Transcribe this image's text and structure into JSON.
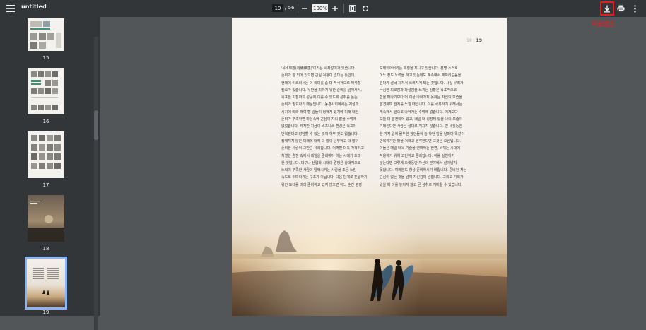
{
  "toolbar": {
    "document_title": "untitled",
    "current_page": "19",
    "page_count": "/ 56",
    "zoom_level": "100%"
  },
  "sidebar": {
    "thumbnails": [
      {
        "label": "15"
      },
      {
        "label": "16"
      },
      {
        "label": "17"
      },
      {
        "label": "18"
      },
      {
        "label": "19"
      }
    ]
  },
  "annotation": {
    "label": "다운로드"
  },
  "page": {
    "page_number": "19",
    "left_column": [
      "'유비무환(有備無患)'이라는 사자성어가 있습니다.",
      "준비가 잘 되어 있으면 근심 걱정이 없다는 뜻인데,",
      "현대에 이르러서는 이 의미를 좀 더 적극적으로 해석할",
      "필요가 있습니다. 우환을 피하기 위한 준비를 넘어서서,",
      "목표한 지점까지 성공에 이를 수 있도록 성취를 돕는",
      "준비가 필요하기 때문입니다. 농경사회에서는 계절과",
      "시기에 따라 해야 할 일들이 정해져 있기에 미래 대한",
      "준비가 부족하면 마음속에 근심이 자리 잡을 수밖에",
      "없었습니다. 하지만 지금의 비즈니스 환경은 목표이",
      "반복된다고 장담할 수 있는 것이 아무 것도 없습니다.",
      "정해지지 않은 미래에 대해 더 많이 공부하고 더 많이",
      "준비한 사람이 그만큼 유리합니다. 어쩌면 더욱 가혹하고",
      "치열한 경쟁 속에서 내일을 준비해야 하는 시대가 도래",
      "한 것입니다. 더구나 산업화 시대의 경쟁은 상대적으로",
      "노력이 부족한 사람이 탈락시키는 사람을 조금 느린",
      "속도로 뒤따라가는 구조가 아닙니다. 다음 단계로 진입하기",
      "위한 토대를 미리 준비하고 있지 않으면 어느 순간 영영"
    ],
    "right_column": [
      "도태되어버리는 특징을 지니고 있습니다. 분명 스스로",
      "어느 정도 노력을 하고 있는데도 계속해서 제자리걸음을",
      "걷다가 결국 지쳐서 쓰러지게 되는 것입니다. 사실 우리가",
      "극심한 피로감과 좌절감을 느끼는 상황은 목표적으로",
      "힘을 떠나기보다 더 이상 나아가지 못하는 자신의 모습을",
      "발견하며 한계를 느낄 때입니다. 이를 극복하기 위해서는",
      "계속해서 앞으로 나아가는 수밖에 없습니다. 어제보다",
      "오늘 더 발전되어 있고, 내일 더 성장해 있을 나의 모습이",
      "기대된다면 사람은 절대로 지치지 않습니다. 긴 세월동안",
      "한 가지 일에 몰두한 장인들이 늘 하던 일을 날마다 똑같이",
      "반복하기만 했을 거라고 생각한다면 그것은 오산입니다.",
      "이들은 매일 더욱 기술을 연마하는 한편, 바뀌는 시대에",
      "적응하기 위해 고민하고 준비합니다. 이를 실천하지",
      "않는다면 그렇게 오랫동안 자신의 분야에서 살아남지",
      "못합니다. 여러분도 항상 준비하시기 바랍니다. 준비된 자는",
      "근심이 없는 것을 넘어 자신감이 넘칩니다. 그리고 기회가",
      "왔을 때 이를 놓치지 않고 큰 성취로 거머쥘 수 있습니다."
    ]
  },
  "colors": {
    "toolbar_bg": "#323639",
    "viewer_bg": "#525659",
    "accent": "#8ab4f8",
    "annotation_red": "#e02020"
  }
}
